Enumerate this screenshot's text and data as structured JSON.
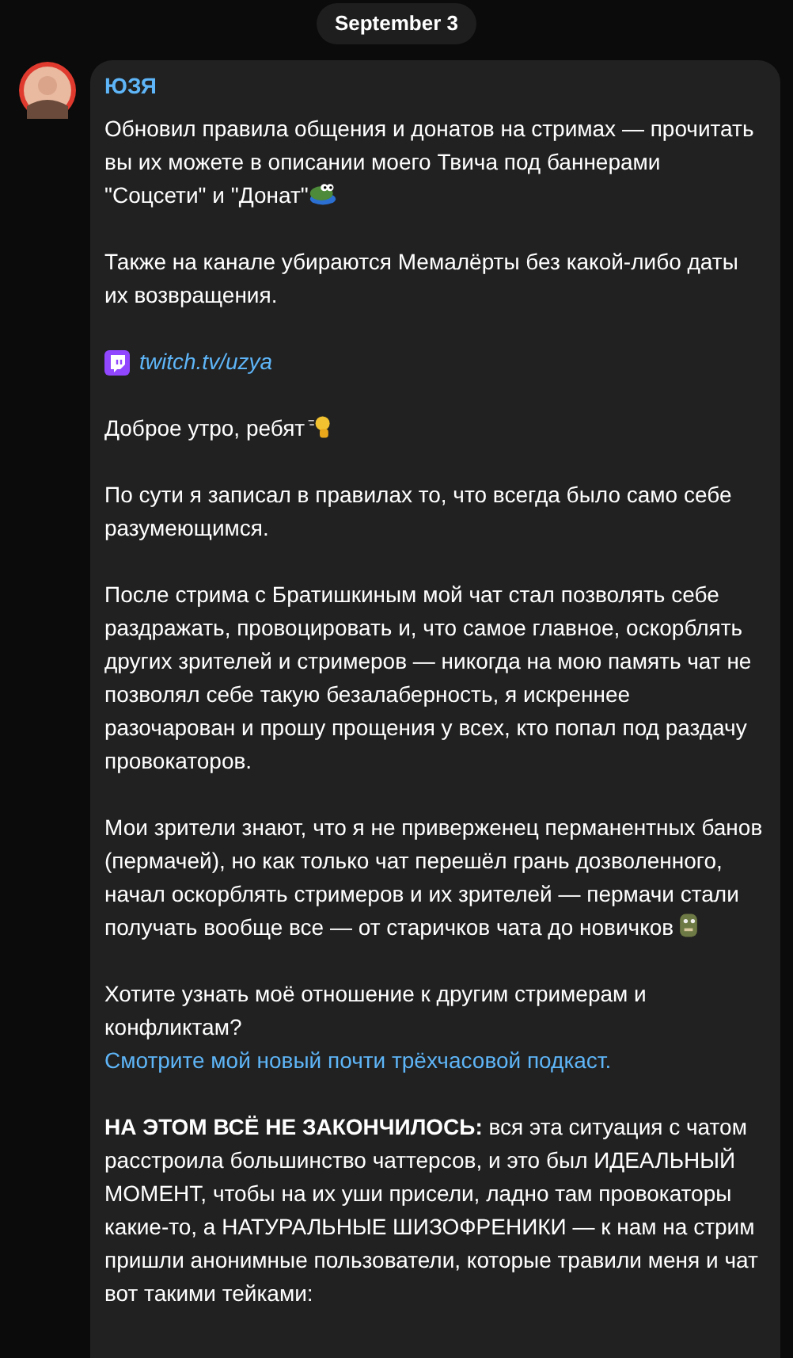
{
  "date": "September 3",
  "message": {
    "author": "ЮЗЯ",
    "paragraphs": [
      {
        "kind": "text",
        "text": "Обновил правила общения и донатов на стримах — прочитать вы их можете в описании моего Твича под баннерами \"Соцсети\" и \"Донат\"",
        "emoji": true
      },
      {
        "kind": "text",
        "text": "Также на канале убираются Мемалёрты без какой-либо даты их возвращения.",
        "emoji": false
      },
      {
        "kind": "link",
        "link": "twitch.tv/uzya"
      },
      {
        "kind": "text",
        "text": "Доброе утро, ребят",
        "emoji": true
      },
      {
        "kind": "text",
        "text": "По сути я записал в правилах то, что всегда было само себе разумеющимся.",
        "emoji": false
      },
      {
        "kind": "text",
        "text": "После стрима с Братишкиным мой чат стал позволять себе раздражать, провоцировать и, что самое главное, оскорблять других зрителей и стримеров — никогда на мою память чат не позволял себе такую безалаберность, я искреннее разочарован и прошу прощения у всех, кто попал под раздачу провокаторов.",
        "emoji": false
      },
      {
        "kind": "text",
        "text": "Мои зрители знают, что я не приверженец перманентных банов (пермачей), но как только чат перешёл грань дозволенного, начал оскорблять стримеров и их зрителей — пермачи стали получать вообще все — от старичков чата до новичков",
        "emoji": true
      },
      {
        "kind": "text_link",
        "text": "Хотите узнать моё отношение к другим стримерам и конфликтам?",
        "link": "Смотрите мой новый почти трёхчасовой подкаст."
      },
      {
        "kind": "text",
        "text": "**НА ЭТОМ ВСЁ НЕ ЗАКОНЧИЛОСЬ:** вся эта ситуация с чатом расстроила большинство чаттерсов, и это был ИДЕАЛЬНЫЙ МОМЕНТ, чтобы на их уши присели, ладно там провокаторы какие-то, а НАТУРАЛЬНЫЕ ШИЗОФРЕНИКИ — к нам на стрим пришли анонимные пользователи, которые травили меня и чат вот такими тейками:",
        "emoji": false
      }
    ]
  }
}
